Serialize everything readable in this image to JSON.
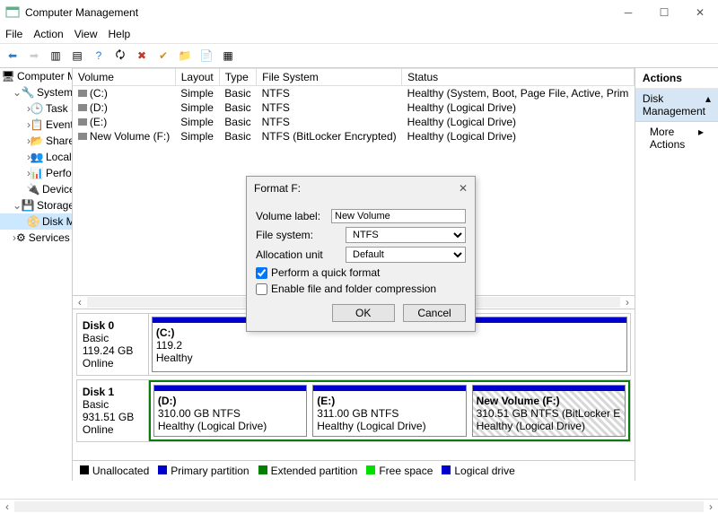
{
  "window": {
    "title": "Computer Management"
  },
  "menu": [
    "File",
    "Action",
    "View",
    "Help"
  ],
  "tree": {
    "root": "Computer Management (Local",
    "system_tools": "System Tools",
    "task_scheduler": "Task Scheduler",
    "event_viewer": "Event Viewer",
    "shared_folders": "Shared Folders",
    "local_users": "Local Users and Groups",
    "performance": "Performance",
    "device_manager": "Device Manager",
    "storage": "Storage",
    "disk_mgmt": "Disk Management",
    "services": "Services and Applications"
  },
  "columns": [
    "Volume",
    "Layout",
    "Type",
    "File System",
    "Status"
  ],
  "volumes": [
    {
      "name": "(C:)",
      "layout": "Simple",
      "type": "Basic",
      "fs": "NTFS",
      "status": "Healthy (System, Boot, Page File, Active, Prim"
    },
    {
      "name": "(D:)",
      "layout": "Simple",
      "type": "Basic",
      "fs": "NTFS",
      "status": "Healthy (Logical Drive)"
    },
    {
      "name": "(E:)",
      "layout": "Simple",
      "type": "Basic",
      "fs": "NTFS",
      "status": "Healthy (Logical Drive)"
    },
    {
      "name": "New Volume (F:)",
      "layout": "Simple",
      "type": "Basic",
      "fs": "NTFS (BitLocker Encrypted)",
      "status": "Healthy (Logical Drive)"
    }
  ],
  "disks": [
    {
      "name": "Disk 0",
      "type": "Basic",
      "size": "119.24 GB",
      "state": "Online",
      "parts": [
        {
          "label": "(C:)",
          "size": "119.2",
          "status": "Healthy",
          "hatched": false
        }
      ]
    },
    {
      "name": "Disk 1",
      "type": "Basic",
      "size": "931.51 GB",
      "state": "Online",
      "parts": [
        {
          "label": "(D:)",
          "size": "310.00 GB NTFS",
          "status": "Healthy (Logical Drive)",
          "hatched": false
        },
        {
          "label": "(E:)",
          "size": "311.00 GB NTFS",
          "status": "Healthy (Logical Drive)",
          "hatched": false
        },
        {
          "label": "New Volume   (F:)",
          "size": "310.51 GB NTFS (BitLocker E",
          "status": "Healthy (Logical Drive)",
          "hatched": true
        }
      ]
    }
  ],
  "legend": {
    "unalloc": "Unallocated",
    "primary": "Primary partition",
    "extended": "Extended partition",
    "free": "Free space",
    "logical": "Logical drive"
  },
  "actions": {
    "header": "Actions",
    "disk_mgmt": "Disk Management",
    "more": "More Actions"
  },
  "dialog": {
    "title": "Format F:",
    "volume_label_lbl": "Volume label:",
    "volume_label_val": "New Volume",
    "fs_lbl": "File system:",
    "fs_val": "NTFS",
    "alloc_lbl": "Allocation unit",
    "alloc_val": "Default",
    "quick": "Perform a quick format",
    "compress": "Enable file and folder compression",
    "ok": "OK",
    "cancel": "Cancel"
  }
}
